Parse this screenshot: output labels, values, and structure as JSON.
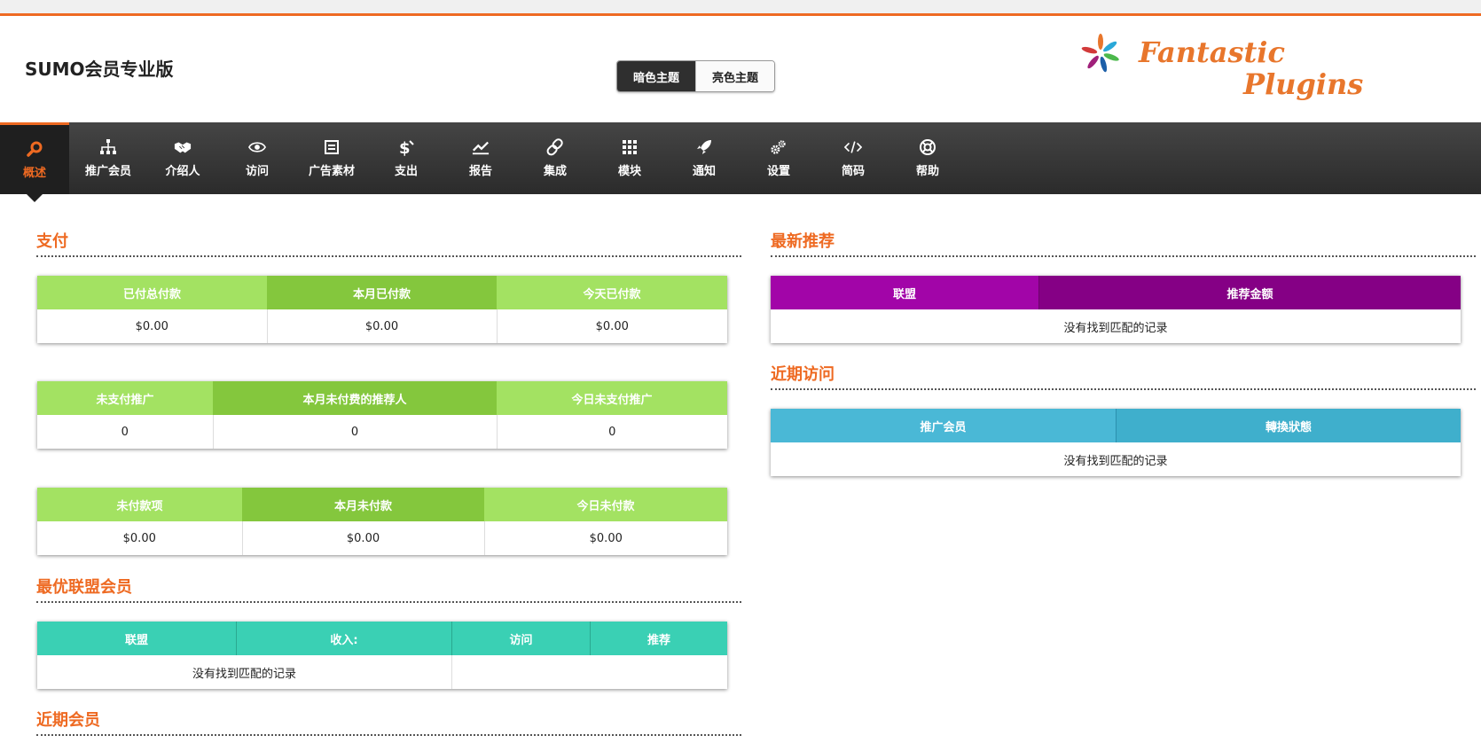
{
  "app": {
    "title": "SUMO会员专业版"
  },
  "theme": {
    "dark_label": "暗色主题",
    "light_label": "亮色主题"
  },
  "logo": {
    "line1": "Fantastic",
    "line2": "Plugins"
  },
  "nav": {
    "items": [
      {
        "label": "概述",
        "icon": "search-icon",
        "active": true
      },
      {
        "label": "推广会员",
        "icon": "sitemap-icon"
      },
      {
        "label": "介绍人",
        "icon": "handshake-icon"
      },
      {
        "label": "访问",
        "icon": "eye-icon"
      },
      {
        "label": "广告素材",
        "icon": "calendar-icon"
      },
      {
        "label": "支出",
        "icon": "dollar-icon"
      },
      {
        "label": "报告",
        "icon": "chart-icon"
      },
      {
        "label": "集成",
        "icon": "link-icon"
      },
      {
        "label": "模块",
        "icon": "grid-icon"
      },
      {
        "label": "通知",
        "icon": "rocket-icon"
      },
      {
        "label": "设置",
        "icon": "gears-icon"
      },
      {
        "label": "简码",
        "icon": "code-icon"
      },
      {
        "label": "帮助",
        "icon": "lifebuoy-icon"
      }
    ]
  },
  "payments": {
    "title": "支付",
    "paid": {
      "headers": [
        "已付总付款",
        "本月已付款",
        "今天已付款"
      ],
      "values": [
        "$0.00",
        "$0.00",
        "$0.00"
      ]
    },
    "unpaid_referrals": {
      "headers": [
        "未支付推广",
        "本月未付费的推荐人",
        "今日未支付推广"
      ],
      "values": [
        "0",
        "0",
        "0"
      ]
    },
    "unpaid": {
      "headers": [
        "未付款项",
        "本月未付款",
        "今日未付款"
      ],
      "values": [
        "$0.00",
        "$0.00",
        "$0.00"
      ]
    }
  },
  "top_affiliates": {
    "title": "最优联盟会员",
    "headers": [
      "联盟",
      "收入:",
      "访问",
      "推荐"
    ],
    "empty": "没有找到匹配的记录"
  },
  "recent_members": {
    "title": "近期会员"
  },
  "latest_referrals": {
    "title": "最新推荐",
    "headers": [
      "联盟",
      "推荐金额"
    ],
    "empty": "没有找到匹配的记录"
  },
  "recent_visits": {
    "title": "近期访问",
    "headers": [
      "推广会员",
      "轉換狀態"
    ],
    "empty": "没有找到匹配的记录"
  }
}
